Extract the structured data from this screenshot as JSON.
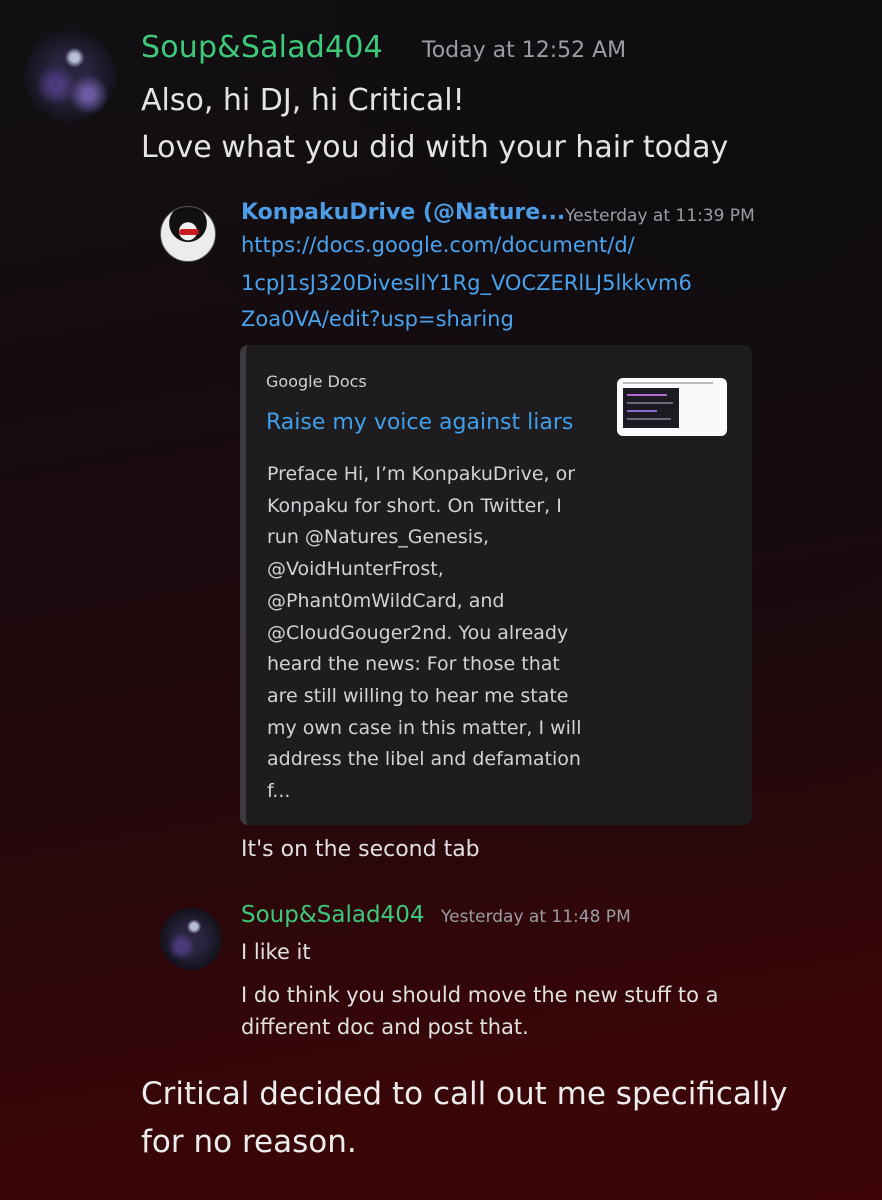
{
  "top_message": {
    "username": "Soup&Salad404",
    "timestamp": "Today at 12:52 AM",
    "lines": [
      "Also, hi DJ, hi Critical!",
      "Love what you did with your hair today"
    ]
  },
  "quoted_message": {
    "username": "KonpakuDrive (@Nature...",
    "timestamp": "Yesterday at 11:39 PM",
    "link_lines": [
      "https://docs.google.com/document/d/",
      "1cpJ1sJ320DivesIlY1Rg_VOCZERlLJ5lkkvm6",
      "Zoa0VA/edit?usp=sharing"
    ],
    "embed": {
      "provider": "Google Docs",
      "title": "Raise my voice against liars",
      "description": "Preface Hi, I’m KonpakuDrive, or\nKonpaku for short. On Twitter, I\nrun @Natures_Genesis,\n@VoidHunterFrost,\n@Phant0mWildCard, and\n@CloudGouger2nd. You already\nheard the news:   For those that\nare still willing to hear me state\nmy own case in this matter, I will\naddress the libel and defamation\nf..."
    },
    "followup": "It's on the second tab"
  },
  "reply_message": {
    "username": "Soup&Salad404",
    "timestamp": "Yesterday at 11:48 PM",
    "lines": [
      "I like it",
      "I do think you should move the new stuff to a",
      "different doc and post that."
    ]
  },
  "caption": {
    "lines": [
      "Critical decided to call out me specifically",
      "for no reason."
    ]
  },
  "colors": {
    "username_green": "#3ec97a",
    "username_blue": "#4d9ce6",
    "link_blue": "#4aa3ee",
    "timestamp_gray": "#9a9da4",
    "embed_bg": "#1e1c1f"
  }
}
